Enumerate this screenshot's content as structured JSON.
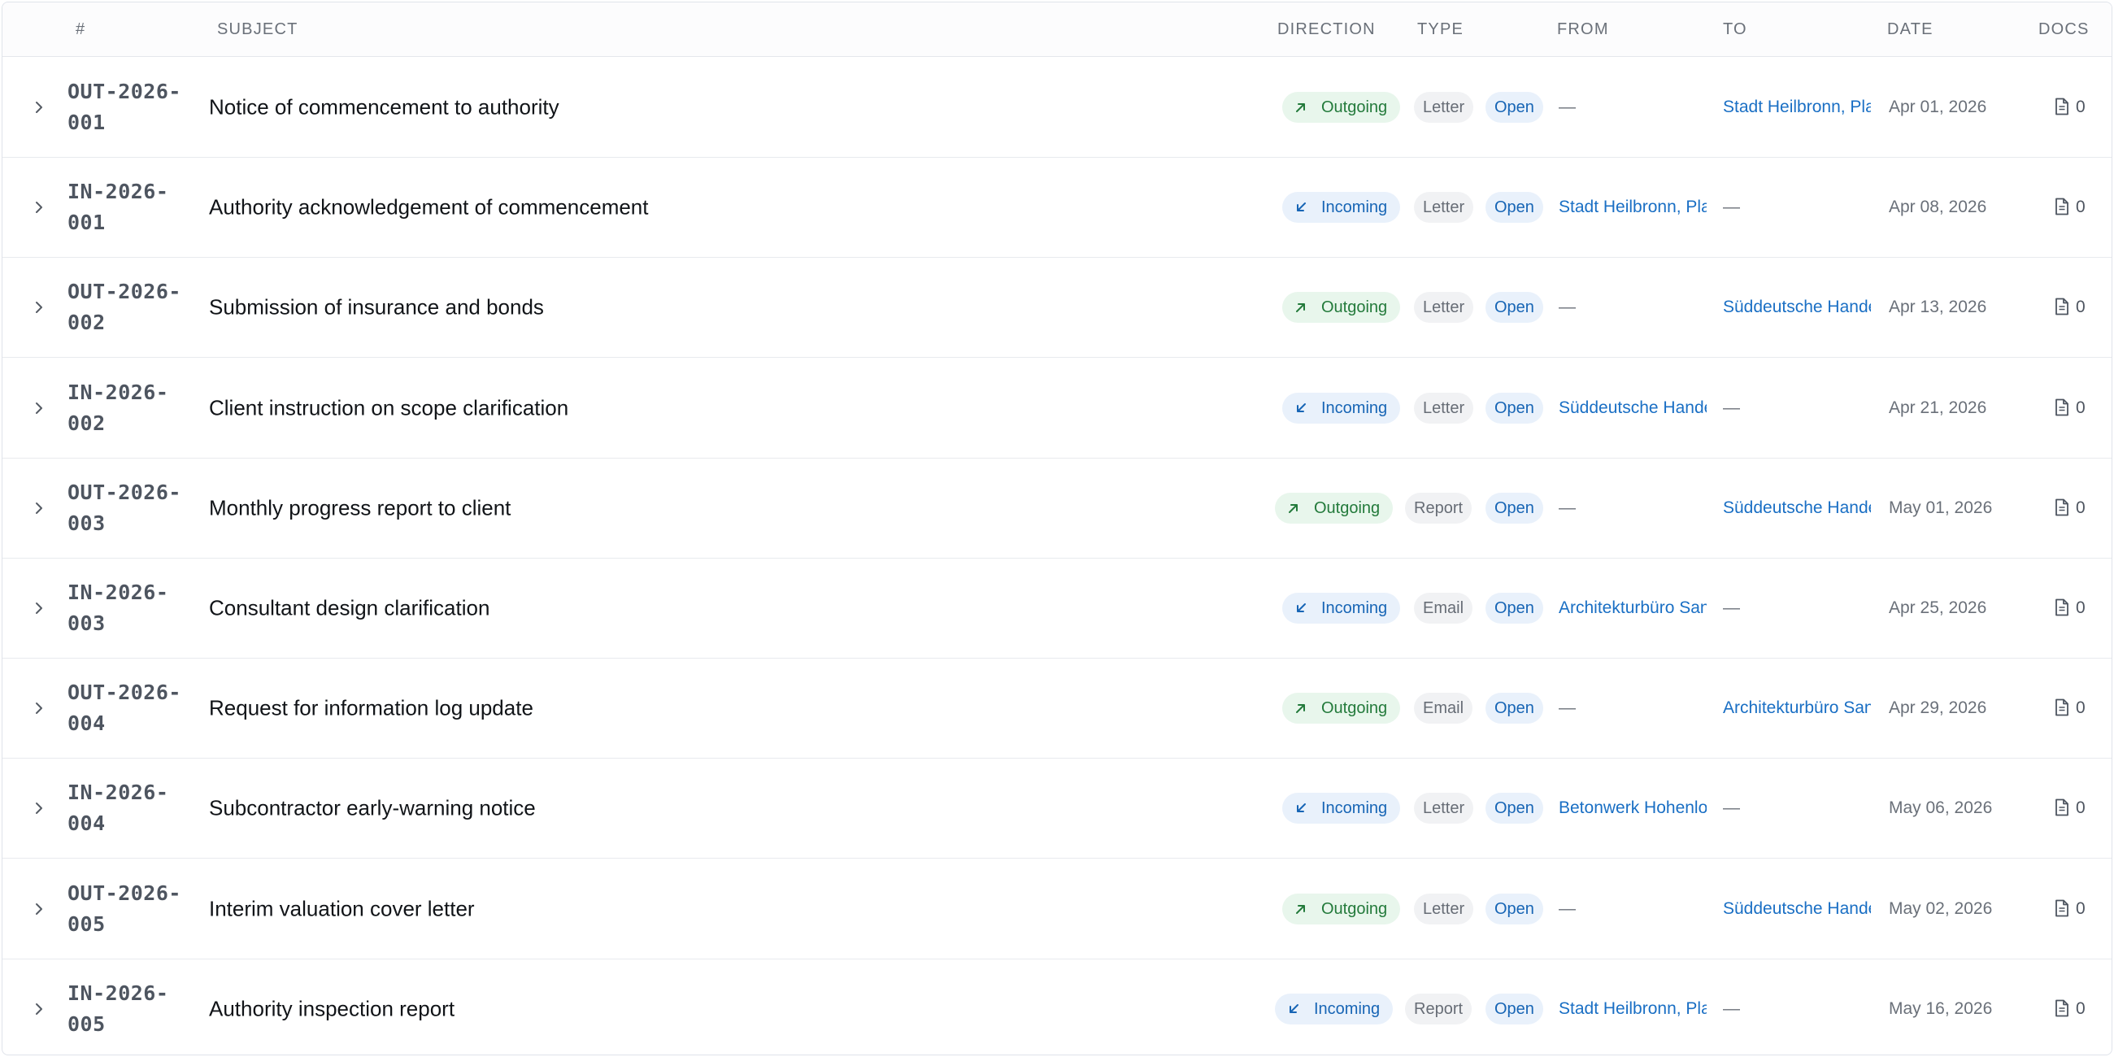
{
  "columns": {
    "num": "#",
    "subject": "SUBJECT",
    "direction": "DIRECTION",
    "type": "TYPE",
    "from": "FROM",
    "to": "TO",
    "date": "DATE",
    "docs": "DOCS"
  },
  "colors": {
    "outgoing": "#237a3b",
    "incoming": "#1765b5",
    "link": "#1a6fc4"
  },
  "rows": [
    {
      "num": "OUT-2026-001",
      "subject": "Notice of commencement to authority",
      "direction": "Outgoing",
      "dir_icon": "arrow-up-right-icon",
      "type": "Letter",
      "status": "Open",
      "from": "—",
      "to": "Stadt Heilbronn, Pla",
      "date": "Apr 01, 2026",
      "docs": "0"
    },
    {
      "num": "IN-2026-001",
      "subject": "Authority acknowledgement of commencement",
      "direction": "Incoming",
      "dir_icon": "arrow-down-left-icon",
      "type": "Letter",
      "status": "Open",
      "from": "Stadt Heilbronn, Pla",
      "to": "—",
      "date": "Apr 08, 2026",
      "docs": "0"
    },
    {
      "num": "OUT-2026-002",
      "subject": "Submission of insurance and bonds",
      "direction": "Outgoing",
      "dir_icon": "arrow-up-right-icon",
      "type": "Letter",
      "status": "Open",
      "from": "—",
      "to": "Süddeutsche Hande",
      "date": "Apr 13, 2026",
      "docs": "0"
    },
    {
      "num": "IN-2026-002",
      "subject": "Client instruction on scope clarification",
      "direction": "Incoming",
      "dir_icon": "arrow-down-left-icon",
      "type": "Letter",
      "status": "Open",
      "from": "Süddeutsche Hande",
      "to": "—",
      "date": "Apr 21, 2026",
      "docs": "0"
    },
    {
      "num": "OUT-2026-003",
      "subject": "Monthly progress report to client",
      "direction": "Outgoing",
      "dir_icon": "arrow-up-right-icon",
      "type": "Report",
      "status": "Open",
      "from": "—",
      "to": "Süddeutsche Hande",
      "date": "May 01, 2026",
      "docs": "0"
    },
    {
      "num": "IN-2026-003",
      "subject": "Consultant design clarification",
      "direction": "Incoming",
      "dir_icon": "arrow-down-left-icon",
      "type": "Email",
      "status": "Open",
      "from": "Architekturbüro San",
      "to": "—",
      "date": "Apr 25, 2026",
      "docs": "0"
    },
    {
      "num": "OUT-2026-004",
      "subject": "Request for information log update",
      "direction": "Outgoing",
      "dir_icon": "arrow-up-right-icon",
      "type": "Email",
      "status": "Open",
      "from": "—",
      "to": "Architekturbüro San",
      "date": "Apr 29, 2026",
      "docs": "0"
    },
    {
      "num": "IN-2026-004",
      "subject": "Subcontractor early-warning notice",
      "direction": "Incoming",
      "dir_icon": "arrow-down-left-icon",
      "type": "Letter",
      "status": "Open",
      "from": "Betonwerk Hohenlo",
      "to": "—",
      "date": "May 06, 2026",
      "docs": "0"
    },
    {
      "num": "OUT-2026-005",
      "subject": "Interim valuation cover letter",
      "direction": "Outgoing",
      "dir_icon": "arrow-up-right-icon",
      "type": "Letter",
      "status": "Open",
      "from": "—",
      "to": "Süddeutsche Hande",
      "date": "May 02, 2026",
      "docs": "0"
    },
    {
      "num": "IN-2026-005",
      "subject": "Authority inspection report",
      "direction": "Incoming",
      "dir_icon": "arrow-down-left-icon",
      "type": "Report",
      "status": "Open",
      "from": "Stadt Heilbronn, Pla",
      "to": "—",
      "date": "May 16, 2026",
      "docs": "0"
    }
  ]
}
